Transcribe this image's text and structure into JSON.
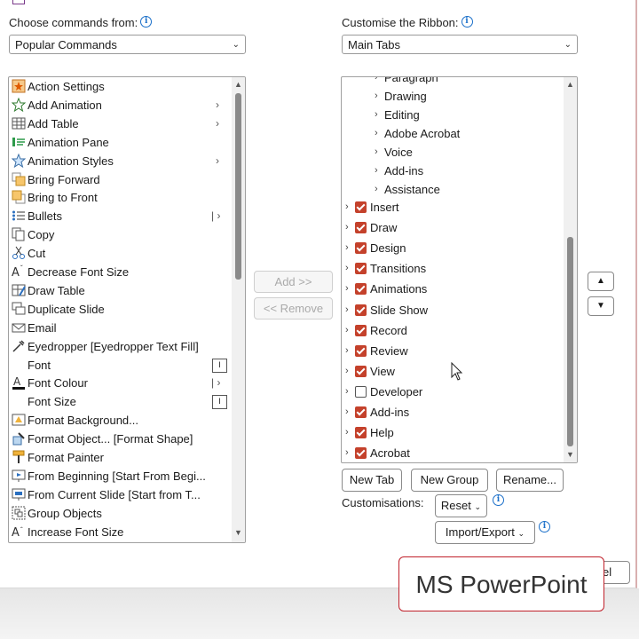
{
  "left_panel": {
    "choose_label": "Choose commands from:",
    "choose_value": "Popular Commands",
    "commands": [
      {
        "label": "Action Settings",
        "icon": "action-settings-icon",
        "sub": ""
      },
      {
        "label": "Add Animation",
        "icon": "add-animation-icon",
        "sub": "›"
      },
      {
        "label": "Add Table",
        "icon": "add-table-icon",
        "sub": "›"
      },
      {
        "label": "Animation Pane",
        "icon": "animation-pane-icon",
        "sub": ""
      },
      {
        "label": "Animation Styles",
        "icon": "animation-styles-icon",
        "sub": "›"
      },
      {
        "label": "Bring Forward",
        "icon": "bring-forward-icon",
        "sub": ""
      },
      {
        "label": "Bring to Front",
        "icon": "bring-to-front-icon",
        "sub": ""
      },
      {
        "label": "Bullets",
        "icon": "bullets-icon",
        "sub": "|›"
      },
      {
        "label": "Copy",
        "icon": "copy-icon",
        "sub": ""
      },
      {
        "label": "Cut",
        "icon": "cut-icon",
        "sub": ""
      },
      {
        "label": "Decrease Font Size",
        "icon": "decrease-font-size-icon",
        "sub": ""
      },
      {
        "label": "Draw Table",
        "icon": "draw-table-icon",
        "sub": ""
      },
      {
        "label": "Duplicate Slide",
        "icon": "duplicate-slide-icon",
        "sub": ""
      },
      {
        "label": "Email",
        "icon": "email-icon",
        "sub": ""
      },
      {
        "label": "Eyedropper [Eyedropper Text Fill]",
        "icon": "eyedropper-icon",
        "sub": ""
      },
      {
        "label": "Font",
        "icon": "",
        "sub": "field"
      },
      {
        "label": "Font Colour",
        "icon": "font-colour-icon",
        "sub": "|›"
      },
      {
        "label": "Font Size",
        "icon": "",
        "sub": "field"
      },
      {
        "label": "Format Background...",
        "icon": "format-background-icon",
        "sub": ""
      },
      {
        "label": "Format Object... [Format Shape]",
        "icon": "format-object-icon",
        "sub": ""
      },
      {
        "label": "Format Painter",
        "icon": "format-painter-icon",
        "sub": ""
      },
      {
        "label": "From Beginning [Start From Begi...",
        "icon": "from-beginning-icon",
        "sub": ""
      },
      {
        "label": "From Current Slide [Start from T...",
        "icon": "from-current-slide-icon",
        "sub": ""
      },
      {
        "label": "Group Objects",
        "icon": "group-objects-icon",
        "sub": ""
      },
      {
        "label": "Increase Font Size",
        "icon": "increase-font-size-icon",
        "sub": ""
      }
    ]
  },
  "middle": {
    "add_label": "Add >>",
    "remove_label": "<< Remove"
  },
  "right_panel": {
    "customise_label": "Customise the Ribbon:",
    "customise_value": "Main Tabs",
    "groups": [
      "Paragraph",
      "Drawing",
      "Editing",
      "Adobe Acrobat",
      "Voice",
      "Add-ins",
      "Assistance"
    ],
    "tabs": [
      {
        "label": "Insert",
        "checked": true
      },
      {
        "label": "Draw",
        "checked": true
      },
      {
        "label": "Design",
        "checked": true
      },
      {
        "label": "Transitions",
        "checked": true
      },
      {
        "label": "Animations",
        "checked": true
      },
      {
        "label": "Slide Show",
        "checked": true
      },
      {
        "label": "Record",
        "checked": true
      },
      {
        "label": "Review",
        "checked": true
      },
      {
        "label": "View",
        "checked": true
      },
      {
        "label": "Developer",
        "checked": false
      },
      {
        "label": "Add-ins",
        "checked": true
      },
      {
        "label": "Help",
        "checked": true
      },
      {
        "label": "Acrobat",
        "checked": true
      }
    ],
    "new_tab": "New Tab",
    "new_group": "New Group",
    "rename": "Rename...",
    "customisations_label": "Customisations:",
    "reset": "Reset",
    "import_export": "Import/Export",
    "move_up": "▲",
    "move_down": "▼"
  },
  "footer": {
    "cancel_partial": "el"
  },
  "overlay": {
    "caption": "MS PowerPoint"
  },
  "colors": {
    "checkbox": "#c4412b",
    "callout_border": "#c0202a"
  }
}
